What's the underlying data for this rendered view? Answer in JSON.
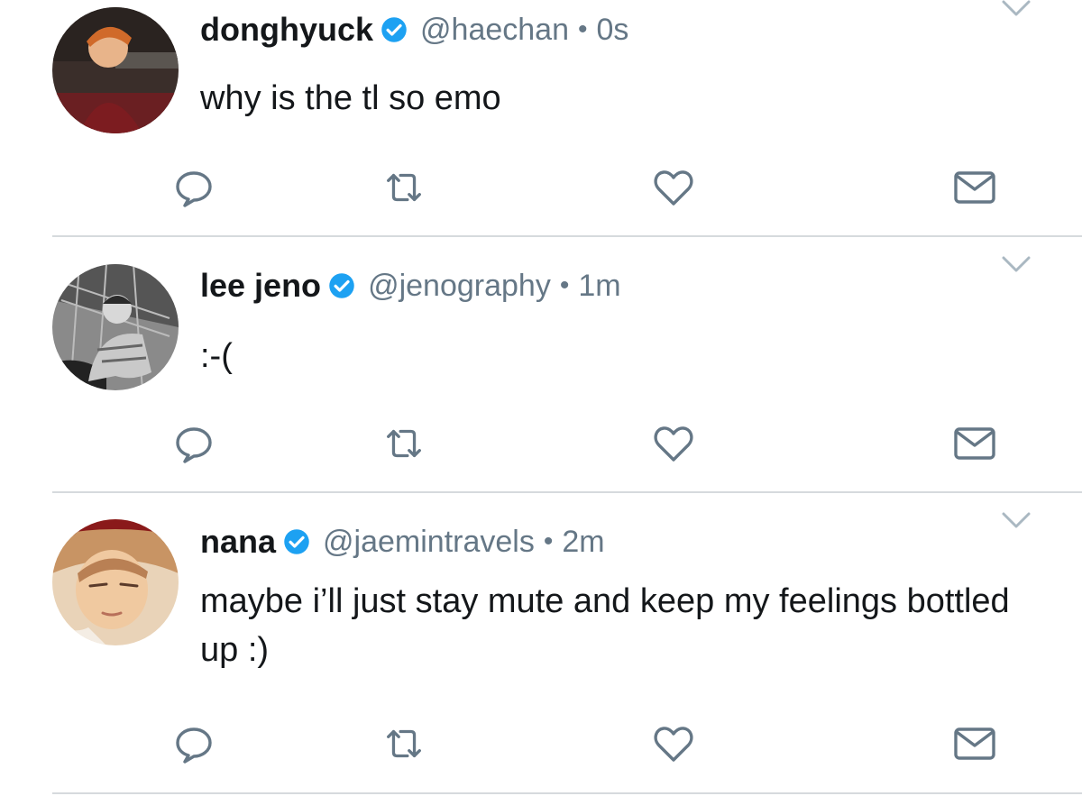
{
  "colors": {
    "name": "#14171a",
    "muted": "#657786",
    "verified": "#1da1f2",
    "icon": "#657786",
    "divider": "#d6dadd"
  },
  "tweets": [
    {
      "name": "donghyuck",
      "handle": "@haechan",
      "separator": "•",
      "time": "0s",
      "text": "why is the tl so emo",
      "avatar_icon": "avatar-photo-icon"
    },
    {
      "name": "lee jeno",
      "handle": "@jenography",
      "separator": "•",
      "time": "1m",
      "text": ":-(",
      "avatar_icon": "avatar-photo-icon"
    },
    {
      "name": "nana",
      "handle": "@jaemintravels",
      "separator": "•",
      "time": "2m",
      "text": "maybe i’ll just stay mute and keep my feelings bottled up :)",
      "avatar_icon": "avatar-photo-icon"
    }
  ],
  "icons": {
    "reply": "reply-icon",
    "retweet": "retweet-icon",
    "like": "heart-icon",
    "dm": "envelope-icon",
    "more": "chevron-down-icon",
    "verified": "verified-badge-icon"
  }
}
